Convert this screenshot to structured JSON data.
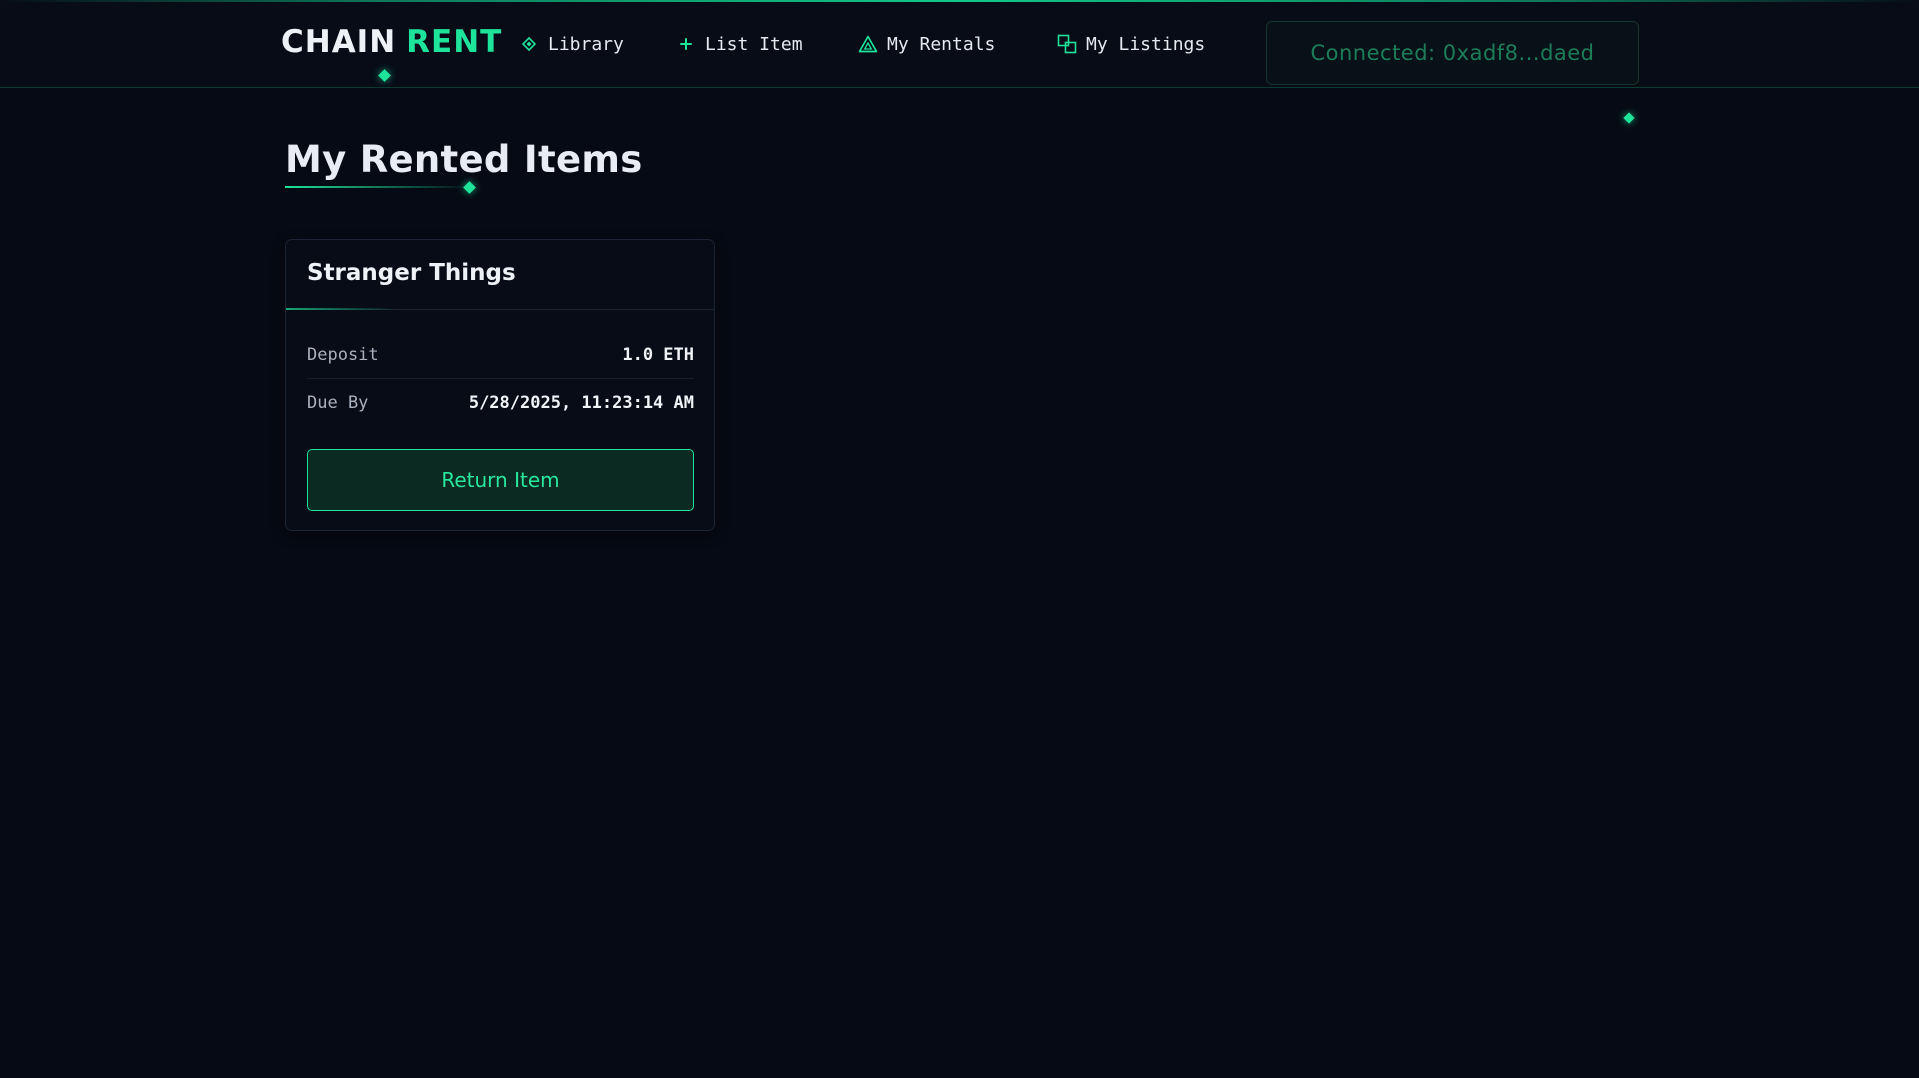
{
  "header": {
    "logo_part1": "CHAIN",
    "logo_part2": "RENT",
    "nav": [
      {
        "label": "Library",
        "icon": "diamond-icon"
      },
      {
        "label": "List Item",
        "icon": "plus-icon"
      },
      {
        "label": "My Rentals",
        "icon": "triangle-icon"
      },
      {
        "label": "My Listings",
        "icon": "stacked-squares-icon"
      }
    ],
    "wallet_status": "Connected: 0xadf8...daed"
  },
  "main": {
    "page_title": "My Rented Items",
    "rentals": [
      {
        "title": "Stranger Things",
        "deposit_label": "Deposit",
        "deposit_value": "1.0 ETH",
        "due_label": "Due By",
        "due_value": "5/28/2025, 11:23:14 AM",
        "return_label": "Return Item"
      }
    ]
  },
  "colors": {
    "background": "#060a14",
    "accent": "#1ee39a",
    "text": "#e6e9ef"
  }
}
